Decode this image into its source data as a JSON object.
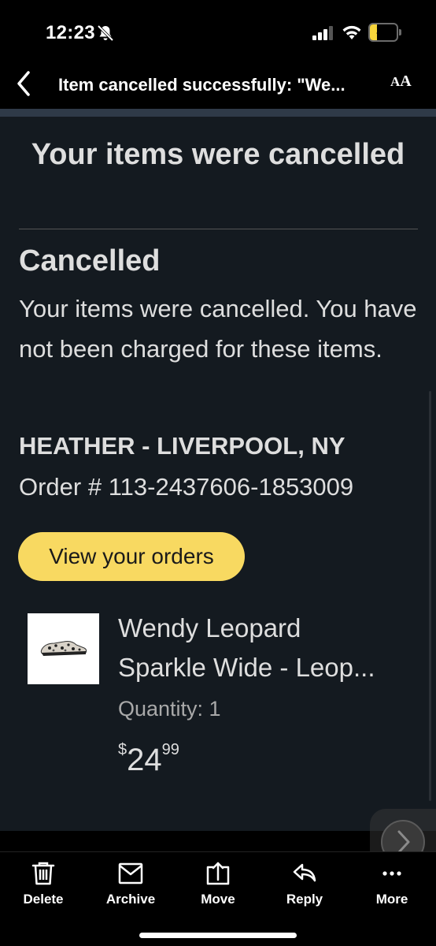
{
  "status_bar": {
    "time": "12:23",
    "battery": "25",
    "battery_level": 0.25
  },
  "nav": {
    "title": "Item cancelled successfully: \"We...",
    "text_size_big": "A",
    "text_size_small": "A"
  },
  "email": {
    "headline": "Your items were cancelled",
    "status_title": "Cancelled",
    "status_description": "Your items were cancelled. You have not been charged for these items.",
    "ship_to": "HEATHER - LIVERPOOL, NY",
    "order_number": "Order # 113-2437606-1853009",
    "view_orders_label": "View your orders",
    "product": {
      "name_line1": "Wendy Leopard",
      "name_line2": "Sparkle Wide - Leop...",
      "quantity": "Quantity: 1",
      "price_currency": "$",
      "price_whole": "24",
      "price_cents": "99"
    }
  },
  "toolbar": {
    "delete": "Delete",
    "archive": "Archive",
    "move": "Move",
    "reply": "Reply",
    "more": "More"
  },
  "colors": {
    "background": "#000000",
    "email_background": "#141a20",
    "button_yellow": "#f8d961",
    "battery_yellow": "#f7d53c",
    "divider_blue": "#2f3a48"
  }
}
